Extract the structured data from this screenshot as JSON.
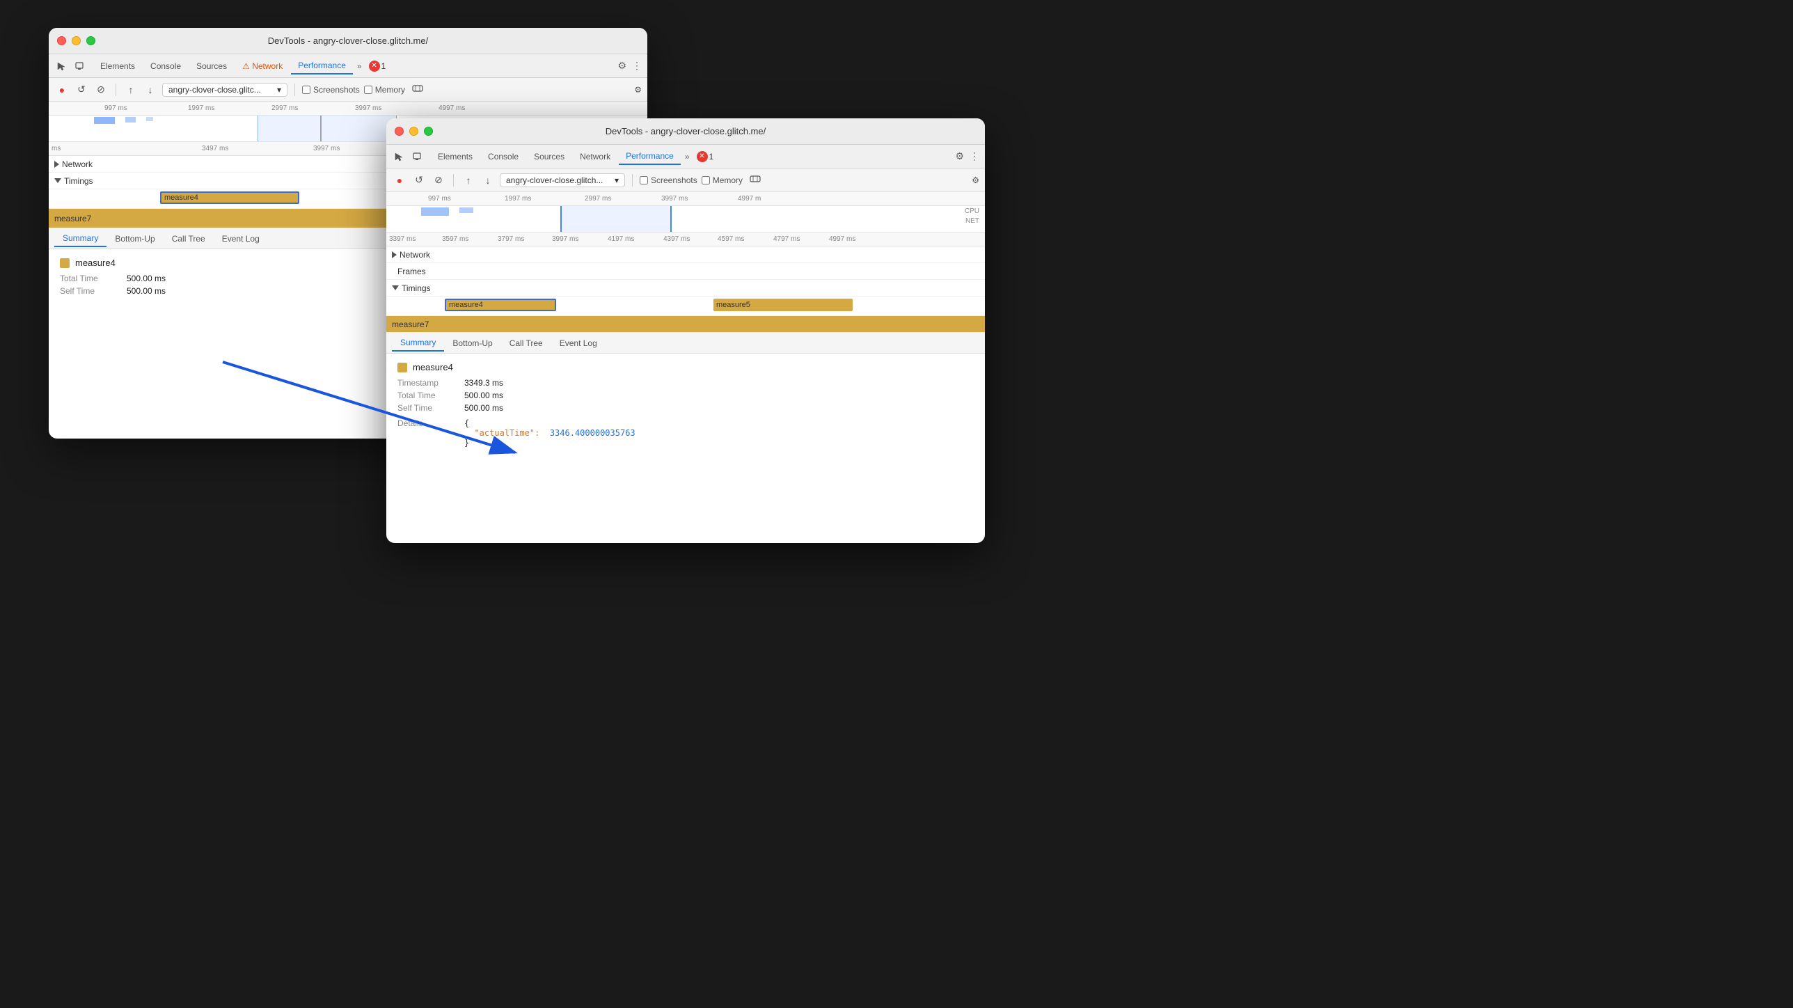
{
  "window1": {
    "title": "DevTools - angry-clover-close.glitch.me/",
    "tabs": [
      "Elements",
      "Console",
      "Sources",
      "Network",
      "Performance"
    ],
    "activeTab": "Performance",
    "toolbar": {
      "url": "angry-clover-close.glitc...",
      "screenshots": "Screenshots",
      "memory": "Memory"
    },
    "ruler": {
      "ticks": [
        "997 ms",
        "1997 ms",
        "2997 ms",
        "3997 ms",
        "4997 ms"
      ]
    },
    "ruler2": {
      "ticks": [
        "ms",
        "3497 ms",
        "3997 ms"
      ]
    },
    "tracks": {
      "network": "Network",
      "timings": "Timings",
      "measure4": "measure4",
      "measure7": "measure7"
    },
    "bottomTabs": [
      "Summary",
      "Bottom-Up",
      "Call Tree",
      "Event Log"
    ],
    "activeBottomTab": "Summary",
    "summary": {
      "name": "measure4",
      "totalTimeLabel": "Total Time",
      "totalTimeVal": "500.00 ms",
      "selfTimeLabel": "Self Time",
      "selfTimeVal": "500.00 ms"
    }
  },
  "window2": {
    "title": "DevTools - angry-clover-close.glitch.me/",
    "tabs": [
      "Elements",
      "Console",
      "Sources",
      "Network",
      "Performance"
    ],
    "activeTab": "Performance",
    "toolbar": {
      "url": "angry-clover-close.glitch...",
      "screenshots": "Screenshots",
      "memory": "Memory"
    },
    "ruler": {
      "ticks": [
        "997 ms",
        "1997 ms",
        "2997 ms",
        "3997 ms",
        "4997 m"
      ]
    },
    "ruler2": {
      "ticks": [
        "3397 ms",
        "3597 ms",
        "3797 ms",
        "3997 ms",
        "4197 ms",
        "4397 ms",
        "4597 ms",
        "4797 ms",
        "4997 ms"
      ]
    },
    "cpuLabel": "CPU",
    "netLabel": "NET",
    "tracks": {
      "frames": "Frames",
      "timings": "Timings",
      "measure4": "measure4",
      "measure5": "measure5",
      "measure7": "measure7"
    },
    "bottomTabs": [
      "Summary",
      "Bottom-Up",
      "Call Tree",
      "Event Log"
    ],
    "activeBottomTab": "Summary",
    "summary": {
      "name": "measure4",
      "timestampLabel": "Timestamp",
      "timestampVal": "3349.3 ms",
      "totalTimeLabel": "Total Time",
      "totalTimeVal": "500.00 ms",
      "selfTimeLabel": "Self Time",
      "selfTimeVal": "500.00 ms",
      "detailsLabel": "Details",
      "detailsBrace1": "{",
      "detailsKey": "\"actualTime\":",
      "detailsVal": "3346.400000035763",
      "detailsBrace2": "}"
    }
  },
  "arrow": {
    "label": "points from window1 summary to window2 timestamp"
  }
}
